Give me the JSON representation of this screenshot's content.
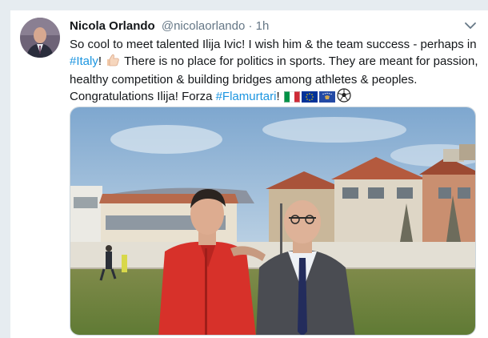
{
  "tweet": {
    "author_name": "Nicola Orlando",
    "author_handle": "@nicolaorlando",
    "separator": "·",
    "time_ago": "1h",
    "text": {
      "part1": "So cool to meet talented Ilija Ivic! I wish him & the team success - perhaps in ",
      "hashtag1": "#Italy",
      "part2": "! ",
      "part3": " There is no place for politics in sports. They are meant for passion, healthy competition & building bridges among athletes & peoples. Congratulations Ilija! Forza ",
      "hashtag2": "#Flamurtari",
      "part4": "! "
    },
    "icons": {
      "avatar": "profile-photo",
      "caret": "chevron-down-icon",
      "thumbs_up": "thumbs-up-emoji",
      "italy_flag": "italy-flag-emoji",
      "eu_flag": "eu-flag-emoji",
      "kosovo_flag": "kosovo-flag-emoji",
      "soccer_ball": "soccer-ball-emoji"
    },
    "colors": {
      "link": "#1b95e0",
      "text": "#14171a",
      "secondary": "#657786"
    }
  }
}
